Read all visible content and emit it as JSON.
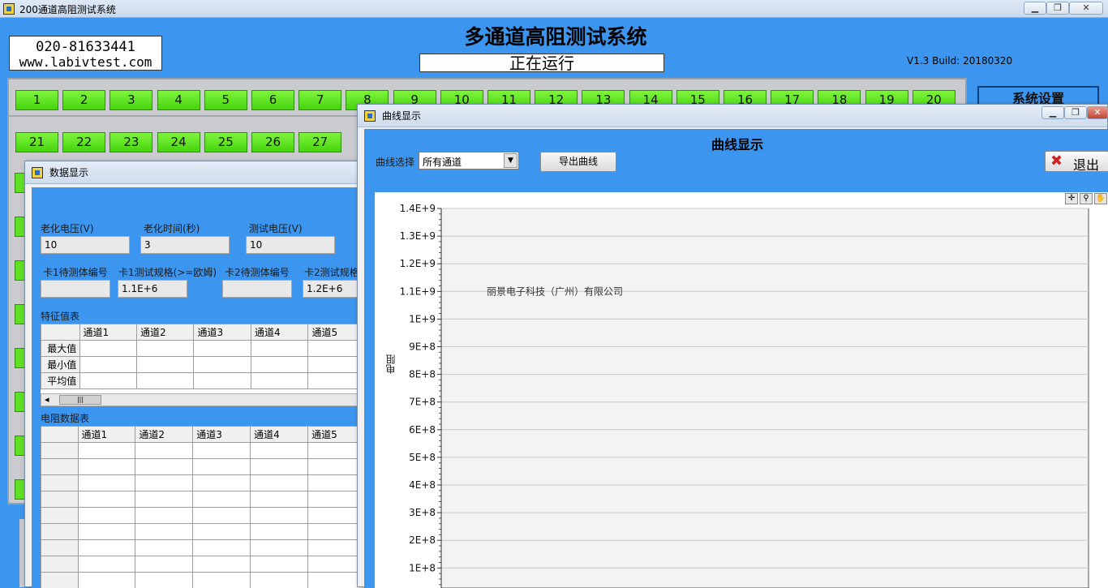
{
  "main_window": {
    "title": "200通道高阻测试系统",
    "minimize": "▁",
    "restore": "❐",
    "close": "✕"
  },
  "header": {
    "phone": "020-81633441",
    "website": "www.labivtest.com",
    "system_title": "多通道高阻测试系统",
    "status": "正在运行",
    "version": "V1.3 Build: 20180320"
  },
  "channels": {
    "row1": [
      "1",
      "2",
      "3",
      "4",
      "5",
      "6",
      "7",
      "8",
      "9",
      "10",
      "11",
      "12",
      "13",
      "14",
      "15",
      "16",
      "17",
      "18",
      "19",
      "20"
    ],
    "row2": [
      "21",
      "22",
      "23",
      "24",
      "25",
      "26",
      "27"
    ]
  },
  "settings_button": "系统设置",
  "data_window": {
    "title": "数据显示",
    "aging_voltage_label": "老化电压(V)",
    "aging_voltage": "10",
    "aging_time_label": "老化时间(秒)",
    "aging_time": "3",
    "test_voltage_label": "测试电压(V)",
    "test_voltage": "10",
    "card1_id_label": "卡1待测体编号",
    "card1_id": "",
    "card1_spec_label": "卡1测试规格(>=欧姆)",
    "card1_spec": "1.1E+6",
    "card2_id_label": "卡2待测体编号",
    "card2_id": "",
    "card2_spec_label": "卡2测试规格",
    "card2_spec": "1.2E+6",
    "feature_table_label": "特征值表",
    "columns": [
      "通道1",
      "通道2",
      "通道3",
      "通道4",
      "通道5"
    ],
    "feature_rows": [
      "最大值",
      "最小值",
      "平均值"
    ],
    "scroll_left": "◂",
    "scroll_grip": "|||",
    "resistance_table_label": "电阻数据表"
  },
  "curve_window": {
    "title": "曲线显示",
    "heading": "曲线显示",
    "select_label": "曲线选择",
    "select_value": "所有通道",
    "select_arrow": "▼",
    "export_button": "导出曲线",
    "exit_button": "退出",
    "exit_icon": "✖",
    "minimize": "▁",
    "restore": "❐",
    "close": "✕",
    "tools": [
      "✛",
      "⚲",
      "✋"
    ]
  },
  "chart_data": {
    "type": "line",
    "ylabel": "电阻",
    "ylim": [
      0,
      1400000000
    ],
    "yticks": [
      "1.4E+9",
      "1.3E+9",
      "1.2E+9",
      "1.1E+9",
      "1E+9",
      "9E+8",
      "8E+8",
      "7E+8",
      "6E+8",
      "5E+8",
      "4E+8",
      "3E+8",
      "2E+8",
      "1E+8"
    ],
    "ytick_values": [
      1400000000,
      1300000000,
      1200000000,
      1100000000,
      1000000000,
      900000000,
      800000000,
      700000000,
      600000000,
      500000000,
      400000000,
      300000000,
      200000000,
      100000000
    ],
    "annotation": "丽景电子科技（广州）有限公司",
    "grid": true,
    "series": []
  }
}
